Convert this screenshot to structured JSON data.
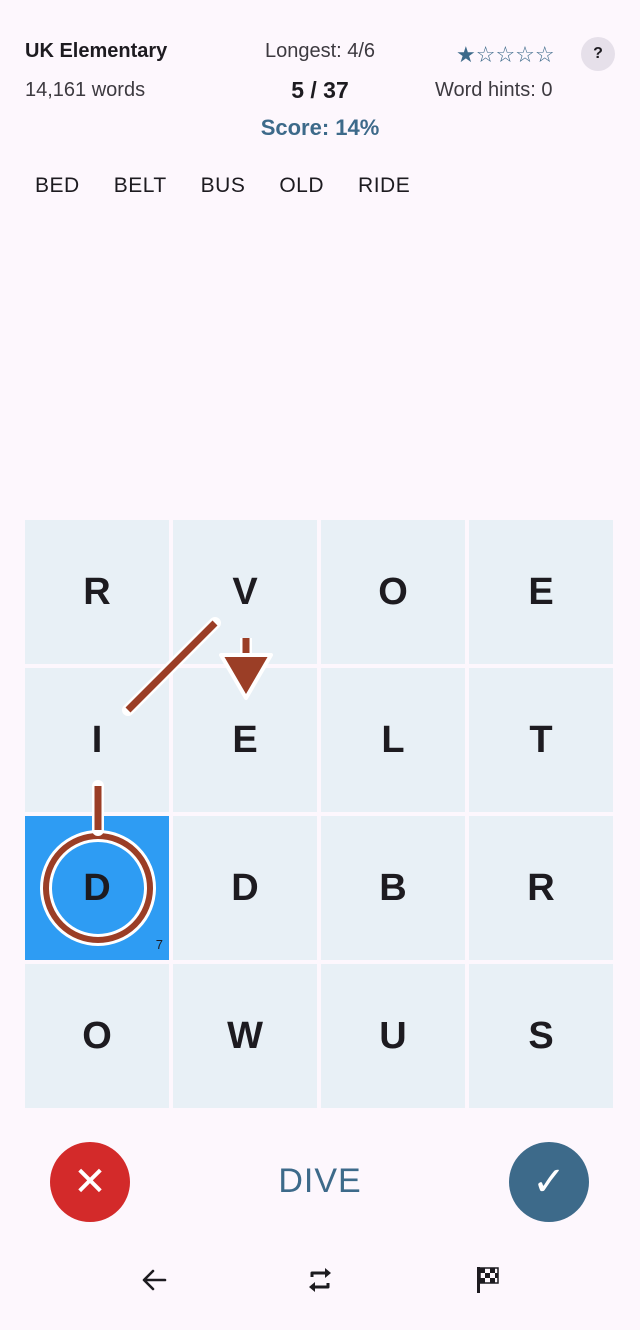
{
  "header": {
    "title": "UK Elementary",
    "word_count": "14,161 words",
    "longest": "Longest: 4/6",
    "progress": "5 / 37",
    "score": "Score: 14%",
    "stars": "★☆☆☆☆",
    "help_label": "?",
    "word_hints": "Word hints: 0"
  },
  "found_words": [
    "BED",
    "BELT",
    "BUS",
    "OLD",
    "RIDE"
  ],
  "grid": {
    "rows": [
      [
        "R",
        "V",
        "O",
        "E"
      ],
      [
        "I",
        "E",
        "L",
        "T"
      ],
      [
        "D",
        "D",
        "B",
        "R"
      ],
      [
        "O",
        "W",
        "U",
        "S"
      ]
    ],
    "selected_cell_count": "7"
  },
  "controls": {
    "clear_label": "✕",
    "current_word": "DIVE",
    "submit_label": "✓"
  },
  "colors": {
    "accent": "#3d6a8a",
    "selected_cell": "#2e9cf3",
    "cell": "#e8f0f6",
    "path": "#9b3e26",
    "clear_button": "#d32a2a"
  },
  "icons": {
    "back": "back-arrow-icon",
    "shuffle": "rotate-icon",
    "finish": "checkered-flag-icon"
  }
}
